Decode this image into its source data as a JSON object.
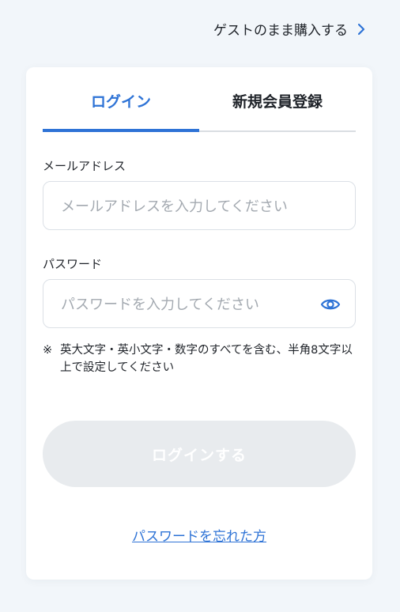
{
  "guest": {
    "label": "ゲストのまま購入する"
  },
  "tabs": [
    {
      "label": "ログイン",
      "active": true
    },
    {
      "label": "新規会員登録",
      "active": false
    }
  ],
  "email": {
    "label": "メールアドレス",
    "placeholder": "メールアドレスを入力してください",
    "value": ""
  },
  "password": {
    "label": "パスワード",
    "placeholder": "パスワードを入力してください",
    "value": ""
  },
  "note": {
    "mark": "※",
    "text": "英大文字・英小文字・数字のすべてを含む、半角8文字以上で設定してください"
  },
  "login_button": {
    "label": "ログインする",
    "enabled": false
  },
  "forgot_link": {
    "label": "パスワードを忘れた方"
  },
  "colors": {
    "accent": "#2e73d6",
    "background": "#f2f6fa",
    "disabled_button": "#e8ebee"
  },
  "icons": {
    "guest_arrow": "chevron-right-icon",
    "password_toggle": "eye-icon"
  }
}
